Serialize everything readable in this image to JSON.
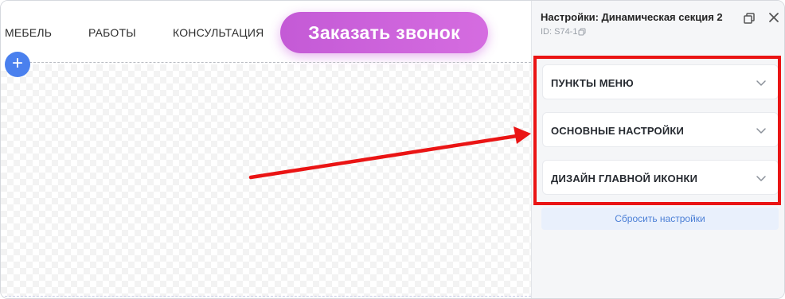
{
  "nav": {
    "items": [
      "МЕБЕЛЬ",
      "РАБОТЫ",
      "КОНСУЛЬТАЦИЯ"
    ],
    "cta_label": "Заказать звонок",
    "add_symbol": "+"
  },
  "panel": {
    "title": "Настройки: Динамическая секция 2",
    "id_label": "ID: S74-1",
    "sections": [
      {
        "label": "ПУНКТЫ МЕНЮ"
      },
      {
        "label": "ОСНОВНЫЕ НАСТРОЙКИ"
      },
      {
        "label": "ДИЗАЙН ГЛАВНОЙ ИКОНКИ"
      }
    ],
    "reset_label": "Сбросить настройки"
  },
  "colors": {
    "cta": "#c45ad6",
    "add_button": "#4a80ee",
    "highlight": "#ea1414",
    "reset_text": "#4b7fd6"
  },
  "icons": {
    "copy": "copy-icon",
    "window": "window-restore-icon",
    "close": "close-icon",
    "chevron": "chevron-down-icon",
    "add": "plus-icon"
  }
}
